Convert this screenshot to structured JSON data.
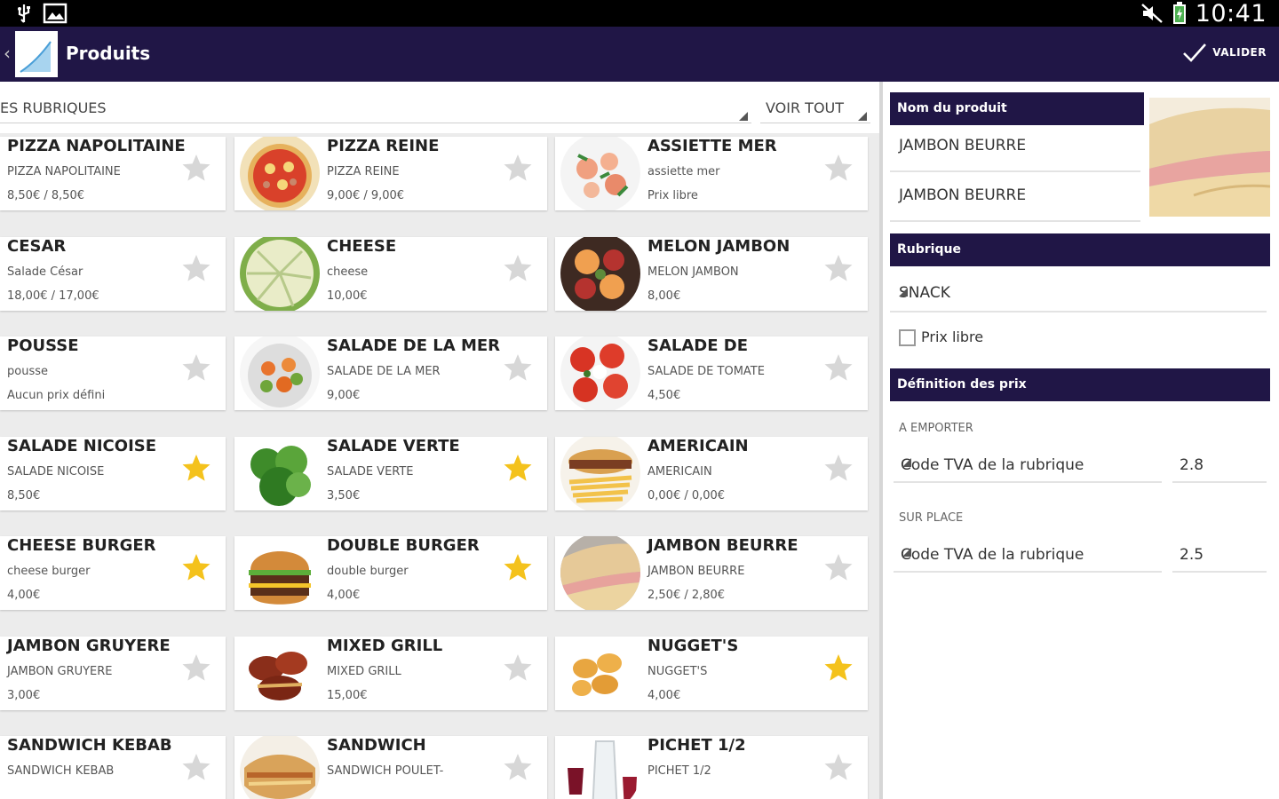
{
  "status_bar": {
    "time": "10:41",
    "icons": [
      "usb-icon",
      "image-icon",
      "mute-icon",
      "battery-icon"
    ]
  },
  "action_bar": {
    "back_glyph": "‹",
    "title": "Produits",
    "valider_label": "VALIDER"
  },
  "filters": {
    "rubriques": "ES RUBRIQUES",
    "voir_tout": "VOIR TOUT"
  },
  "products": [
    {
      "name": "PIZZA NAPOLITAINE",
      "sub": "PIZZA NAPOLITAINE",
      "price": "8,50€ / 8,50€",
      "favorite": false,
      "image": null
    },
    {
      "name": "PIZZA REINE",
      "sub": "PIZZA REINE",
      "price": "9,00€ / 9,00€",
      "favorite": false,
      "image": "pizza"
    },
    {
      "name": "ASSIETTE MER",
      "sub": "assiette mer",
      "price": "Prix libre",
      "favorite": false,
      "image": "seafood"
    },
    {
      "name": "CESAR",
      "sub": "Salade César",
      "price": "18,00€ / 17,00€",
      "favorite": false,
      "image": null
    },
    {
      "name": "CHEESE",
      "sub": "cheese",
      "price": "10,00€",
      "favorite": false,
      "image": "cheese"
    },
    {
      "name": "MELON JAMBON",
      "sub": "MELON JAMBON",
      "price": "8,00€",
      "favorite": false,
      "image": "melon"
    },
    {
      "name": "POUSSE",
      "sub": "pousse",
      "price": "Aucun prix défini",
      "favorite": false,
      "image": null
    },
    {
      "name": "SALADE DE LA MER",
      "sub": "SALADE DE LA MER",
      "price": "9,00€",
      "favorite": false,
      "image": "salad-sea"
    },
    {
      "name": "SALADE DE",
      "sub": "SALADE DE TOMATE",
      "price": "4,50€",
      "favorite": false,
      "image": "tomato"
    },
    {
      "name": "SALADE NICOISE",
      "sub": "SALADE NICOISE",
      "price": "8,50€",
      "favorite": true,
      "image": null
    },
    {
      "name": "SALADE VERTE",
      "sub": "SALADE VERTE",
      "price": "3,50€",
      "favorite": true,
      "image": "green-salad"
    },
    {
      "name": "AMERICAIN",
      "sub": "AMERICAIN",
      "price": "0,00€ / 0,00€",
      "favorite": false,
      "image": "americain"
    },
    {
      "name": "CHEESE BURGER",
      "sub": "cheese burger",
      "price": "4,00€",
      "favorite": true,
      "image": null
    },
    {
      "name": "DOUBLE BURGER",
      "sub": "double burger",
      "price": "4,00€",
      "favorite": true,
      "image": "burger"
    },
    {
      "name": "JAMBON BEURRE",
      "sub": "JAMBON BEURRE",
      "price": "2,50€ / 2,80€",
      "favorite": false,
      "image": "baguette"
    },
    {
      "name": "JAMBON GRUYERE",
      "sub": "JAMBON GRUYERE",
      "price": "3,00€",
      "favorite": false,
      "image": null
    },
    {
      "name": "MIXED GRILL",
      "sub": "MIXED GRILL",
      "price": "15,00€",
      "favorite": false,
      "image": "grill"
    },
    {
      "name": "NUGGET'S",
      "sub": "NUGGET'S",
      "price": "4,00€",
      "favorite": true,
      "image": "nuggets"
    },
    {
      "name": "SANDWICH KEBAB",
      "sub": "SANDWICH KEBAB",
      "price": "",
      "favorite": false,
      "image": null
    },
    {
      "name": "SANDWICH",
      "sub": "SANDWICH POULET-",
      "price": "",
      "favorite": false,
      "image": "sandwich"
    },
    {
      "name": "PICHET 1/2",
      "sub": "PICHET 1/2",
      "price": "",
      "favorite": false,
      "image": "wine"
    }
  ],
  "detail": {
    "nom_header": "Nom du produit",
    "name_field": "JAMBON BEURRE",
    "label_field": "JAMBON BEURRE",
    "rubrique_header": "Rubrique",
    "rubrique_value": "SNACK",
    "prix_libre_label": "Prix libre",
    "prix_libre_checked": false,
    "prix_header": "Définition des prix",
    "emporter_label": "A EMPORTER",
    "emporter_tva": "Code TVA de la rubrique",
    "emporter_value": "2.8",
    "surplace_label": "SUR PLACE",
    "surplace_tva": "Code TVA de la rubrique",
    "surplace_value": "2.5"
  },
  "colors": {
    "primary": "#201646",
    "star_active": "#f4c21c",
    "star_inactive": "#d7d7d7"
  }
}
